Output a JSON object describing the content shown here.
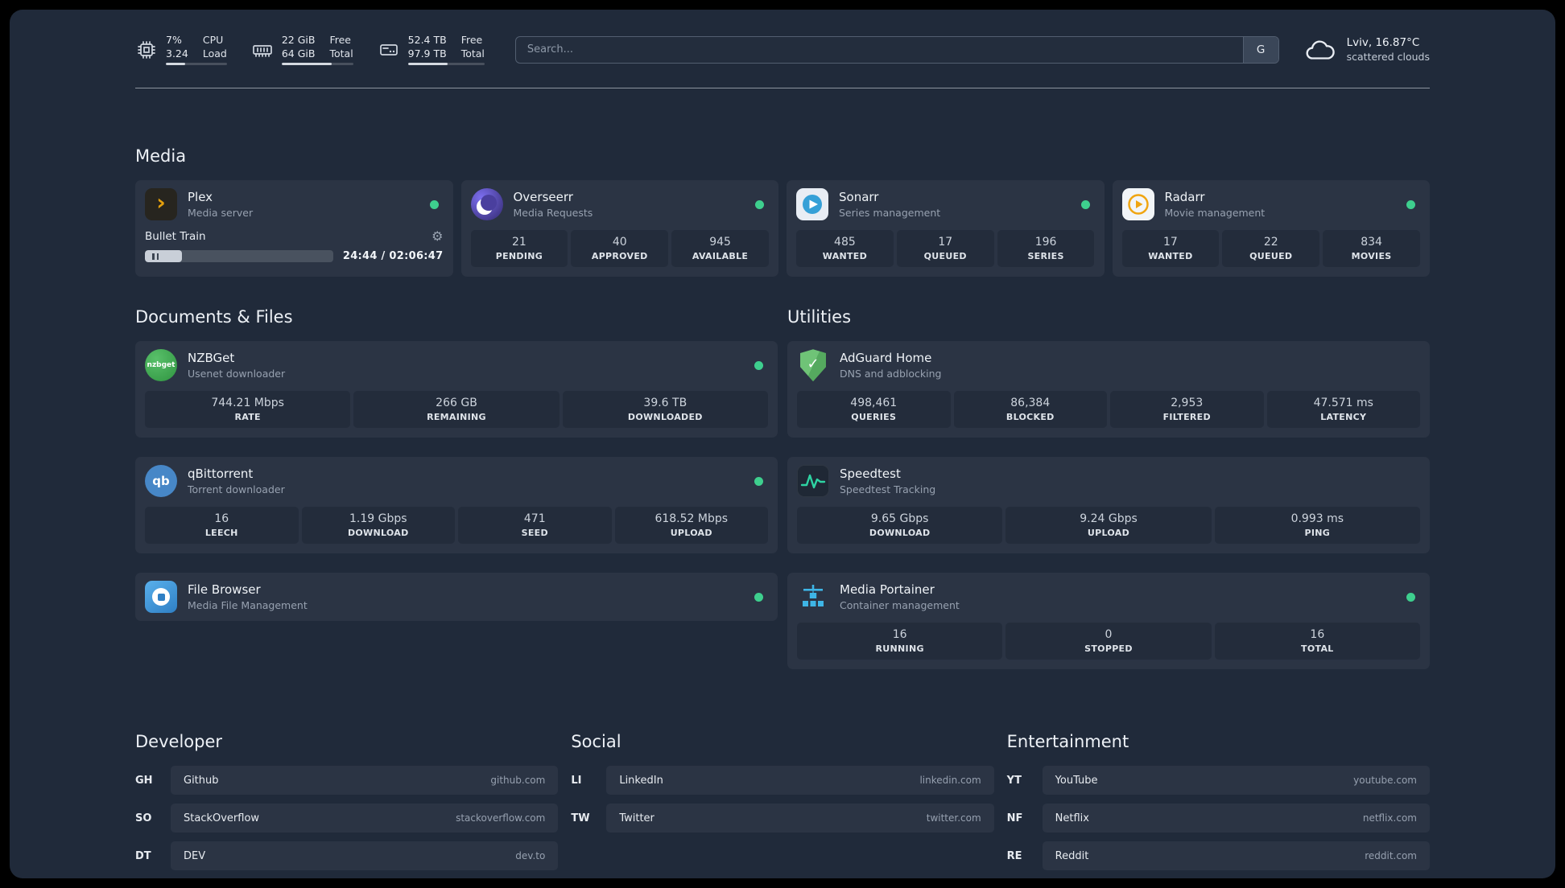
{
  "theme": {
    "page_background": "#202a3a",
    "card_background": "#2b3444",
    "stat_background": "#232c3b",
    "status_online": "#3ecf8e",
    "plex_amber": "#e5a00d"
  },
  "icons": {
    "cpu": "cpu-icon",
    "memory": "memory-icon",
    "disk": "disk-icon",
    "weather": "cloud-icon",
    "settings": "gear-icon",
    "playback": "pause-icon"
  },
  "topbar": {
    "widgets": [
      {
        "name": "cpu",
        "rows": [
          {
            "value": "7%",
            "label": "CPU"
          },
          {
            "value": "3.24",
            "label": "Load"
          }
        ],
        "progress_pct": 32
      },
      {
        "name": "memory",
        "rows": [
          {
            "value": "22 GiB",
            "label": "Free"
          },
          {
            "value": "64 GiB",
            "label": "Total"
          }
        ],
        "progress_pct": 70
      },
      {
        "name": "disk",
        "rows": [
          {
            "value": "52.4 TB",
            "label": "Free"
          },
          {
            "value": "97.9 TB",
            "label": "Total"
          }
        ],
        "progress_pct": 52
      }
    ],
    "search": {
      "placeholder": "Search...",
      "button": "G"
    },
    "weather": {
      "line1": "Lviv, 16.87°C",
      "line2": "scattered clouds"
    }
  },
  "groups": {
    "media": {
      "title": "Media",
      "services": [
        {
          "name": "Plex",
          "desc": "Media server",
          "online": true,
          "player": {
            "track": "Bullet Train",
            "time": "24:44 / 02:06:47",
            "progress_pct": 19.5
          }
        },
        {
          "name": "Overseerr",
          "desc": "Media Requests",
          "online": true,
          "stats": [
            {
              "value": "21",
              "label": "PENDING"
            },
            {
              "value": "40",
              "label": "APPROVED"
            },
            {
              "value": "945",
              "label": "AVAILABLE"
            }
          ]
        },
        {
          "name": "Sonarr",
          "desc": "Series management",
          "online": true,
          "stats": [
            {
              "value": "485",
              "label": "WANTED"
            },
            {
              "value": "17",
              "label": "QUEUED"
            },
            {
              "value": "196",
              "label": "SERIES"
            }
          ]
        },
        {
          "name": "Radarr",
          "desc": "Movie management",
          "online": true,
          "stats": [
            {
              "value": "17",
              "label": "WANTED"
            },
            {
              "value": "22",
              "label": "QUEUED"
            },
            {
              "value": "834",
              "label": "MOVIES"
            }
          ]
        }
      ]
    },
    "documents": {
      "title": "Documents & Files",
      "services": [
        {
          "name": "NZBGet",
          "desc": "Usenet downloader",
          "online": true,
          "stats": [
            {
              "value": "744.21 Mbps",
              "label": "RATE"
            },
            {
              "value": "266 GB",
              "label": "REMAINING"
            },
            {
              "value": "39.6 TB",
              "label": "DOWNLOADED"
            }
          ]
        },
        {
          "name": "qBittorrent",
          "desc": "Torrent downloader",
          "online": true,
          "stats": [
            {
              "value": "16",
              "label": "LEECH"
            },
            {
              "value": "1.19 Gbps",
              "label": "DOWNLOAD"
            },
            {
              "value": "471",
              "label": "SEED"
            },
            {
              "value": "618.52 Mbps",
              "label": "UPLOAD"
            }
          ]
        },
        {
          "name": "File Browser",
          "desc": "Media File Management",
          "online": true,
          "stats": []
        }
      ]
    },
    "utilities": {
      "title": "Utilities",
      "services": [
        {
          "name": "AdGuard Home",
          "desc": "DNS and adblocking",
          "online": false,
          "stats": [
            {
              "value": "498,461",
              "label": "QUERIES"
            },
            {
              "value": "86,384",
              "label": "BLOCKED"
            },
            {
              "value": "2,953",
              "label": "FILTERED"
            },
            {
              "value": "47.571 ms",
              "label": "LATENCY"
            }
          ]
        },
        {
          "name": "Speedtest",
          "desc": "Speedtest Tracking",
          "online": false,
          "stats": [
            {
              "value": "9.65 Gbps",
              "label": "DOWNLOAD"
            },
            {
              "value": "9.24 Gbps",
              "label": "UPLOAD"
            },
            {
              "value": "0.993 ms",
              "label": "PING"
            }
          ]
        },
        {
          "name": "Media Portainer",
          "desc": "Container management",
          "online": true,
          "stats": [
            {
              "value": "16",
              "label": "RUNNING"
            },
            {
              "value": "0",
              "label": "STOPPED"
            },
            {
              "value": "16",
              "label": "TOTAL"
            }
          ]
        }
      ]
    }
  },
  "bookmarks": {
    "developer": {
      "title": "Developer",
      "items": [
        {
          "abbr": "GH",
          "name": "Github",
          "domain": "github.com"
        },
        {
          "abbr": "SO",
          "name": "StackOverflow",
          "domain": "stackoverflow.com"
        },
        {
          "abbr": "DT",
          "name": "DEV",
          "domain": "dev.to"
        }
      ]
    },
    "social": {
      "title": "Social",
      "items": [
        {
          "abbr": "LI",
          "name": "LinkedIn",
          "domain": "linkedin.com"
        },
        {
          "abbr": "TW",
          "name": "Twitter",
          "domain": "twitter.com"
        }
      ]
    },
    "entertainment": {
      "title": "Entertainment",
      "items": [
        {
          "abbr": "YT",
          "name": "YouTube",
          "domain": "youtube.com"
        },
        {
          "abbr": "NF",
          "name": "Netflix",
          "domain": "netflix.com"
        },
        {
          "abbr": "RE",
          "name": "Reddit",
          "domain": "reddit.com"
        }
      ]
    }
  }
}
